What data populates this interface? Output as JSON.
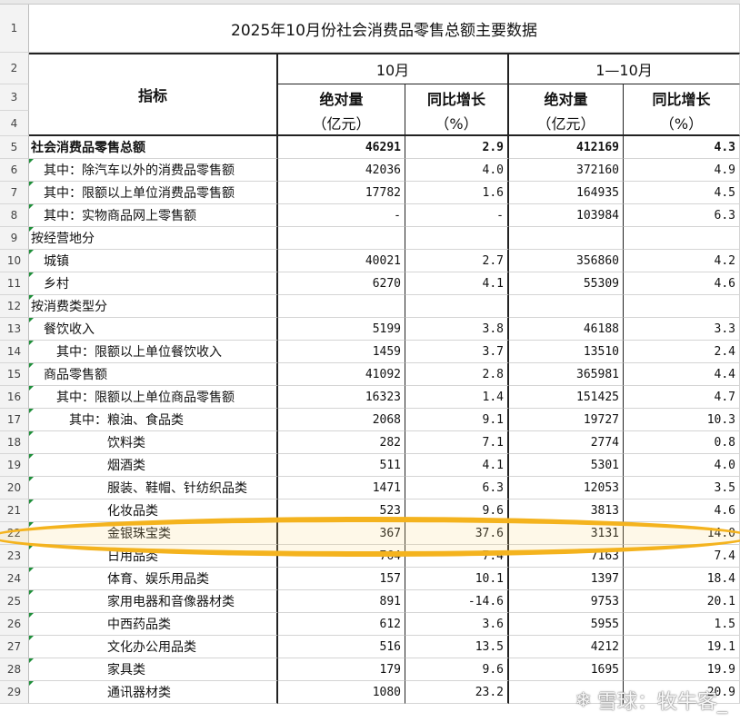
{
  "title": "2025年10月份社会消费品零售总额主要数据",
  "header": {
    "indicator": "指标",
    "period1": "10月",
    "period2": "1—10月",
    "abs_value": "绝对量",
    "yoy_growth": "同比增长",
    "unit_abs": "（亿元）",
    "unit_pct": "（%）"
  },
  "row_numbers": [
    "1",
    "2",
    "3",
    "4",
    "5",
    "6",
    "7",
    "8",
    "9",
    "10",
    "11",
    "12",
    "13",
    "14",
    "15",
    "16",
    "17",
    "18",
    "19",
    "20",
    "21",
    "22",
    "23",
    "24",
    "25",
    "26",
    "27",
    "28",
    "29"
  ],
  "rows": [
    {
      "label": "社会消费品零售总额",
      "indent": 0,
      "bold": true,
      "m_abs": "46291",
      "m_yoy": "2.9",
      "c_abs": "412169",
      "c_yoy": "4.3"
    },
    {
      "label": "其中：除汽车以外的消费品零售额",
      "indent": 1,
      "m_abs": "42036",
      "m_yoy": "4.0",
      "c_abs": "372160",
      "c_yoy": "4.9"
    },
    {
      "label": "其中：限额以上单位消费品零售额",
      "indent": 1,
      "m_abs": "17782",
      "m_yoy": "1.6",
      "c_abs": "164935",
      "c_yoy": "4.5"
    },
    {
      "label": "其中：实物商品网上零售额",
      "indent": 1,
      "m_abs": "-",
      "m_yoy": "-",
      "c_abs": "103984",
      "c_yoy": "6.3"
    },
    {
      "label": "按经营地分",
      "indent": 0,
      "m_abs": "",
      "m_yoy": "",
      "c_abs": "",
      "c_yoy": ""
    },
    {
      "label": "城镇",
      "indent": 1,
      "m_abs": "40021",
      "m_yoy": "2.7",
      "c_abs": "356860",
      "c_yoy": "4.2"
    },
    {
      "label": "乡村",
      "indent": 1,
      "m_abs": "6270",
      "m_yoy": "4.1",
      "c_abs": "55309",
      "c_yoy": "4.6"
    },
    {
      "label": "按消费类型分",
      "indent": 0,
      "m_abs": "",
      "m_yoy": "",
      "c_abs": "",
      "c_yoy": ""
    },
    {
      "label": "餐饮收入",
      "indent": 1,
      "m_abs": "5199",
      "m_yoy": "3.8",
      "c_abs": "46188",
      "c_yoy": "3.3"
    },
    {
      "label": "其中：限额以上单位餐饮收入",
      "indent": 2,
      "m_abs": "1459",
      "m_yoy": "3.7",
      "c_abs": "13510",
      "c_yoy": "2.4"
    },
    {
      "label": "商品零售额",
      "indent": 1,
      "m_abs": "41092",
      "m_yoy": "2.8",
      "c_abs": "365981",
      "c_yoy": "4.4"
    },
    {
      "label": "其中：限额以上单位商品零售额",
      "indent": 2,
      "m_abs": "16323",
      "m_yoy": "1.4",
      "c_abs": "151425",
      "c_yoy": "4.7"
    },
    {
      "label": "其中：粮油、食品类",
      "indent": 3,
      "m_abs": "2068",
      "m_yoy": "9.1",
      "c_abs": "19727",
      "c_yoy": "10.3"
    },
    {
      "label": "饮料类",
      "indent": 4,
      "m_abs": "282",
      "m_yoy": "7.1",
      "c_abs": "2774",
      "c_yoy": "0.8"
    },
    {
      "label": "烟酒类",
      "indent": 4,
      "m_abs": "511",
      "m_yoy": "4.1",
      "c_abs": "5301",
      "c_yoy": "4.0"
    },
    {
      "label": "服装、鞋帽、针纺织品类",
      "indent": 4,
      "m_abs": "1471",
      "m_yoy": "6.3",
      "c_abs": "12053",
      "c_yoy": "3.5"
    },
    {
      "label": "化妆品类",
      "indent": 4,
      "m_abs": "523",
      "m_yoy": "9.6",
      "c_abs": "3813",
      "c_yoy": "4.6"
    },
    {
      "label": "金银珠宝类",
      "indent": 4,
      "m_abs": "367",
      "m_yoy": "37.6",
      "c_abs": "3131",
      "c_yoy": "14.0"
    },
    {
      "label": "日用品类",
      "indent": 4,
      "m_abs": "764",
      "m_yoy": "7.4",
      "c_abs": "7163",
      "c_yoy": "7.4"
    },
    {
      "label": "体育、娱乐用品类",
      "indent": 4,
      "m_abs": "157",
      "m_yoy": "10.1",
      "c_abs": "1397",
      "c_yoy": "18.4"
    },
    {
      "label": "家用电器和音像器材类",
      "indent": 4,
      "m_abs": "891",
      "m_yoy": "-14.6",
      "c_abs": "9753",
      "c_yoy": "20.1"
    },
    {
      "label": "中西药品类",
      "indent": 4,
      "m_abs": "612",
      "m_yoy": "3.6",
      "c_abs": "5955",
      "c_yoy": "1.5"
    },
    {
      "label": "文化办公用品类",
      "indent": 4,
      "m_abs": "516",
      "m_yoy": "13.5",
      "c_abs": "4212",
      "c_yoy": "19.1"
    },
    {
      "label": "家具类",
      "indent": 4,
      "m_abs": "179",
      "m_yoy": "9.6",
      "c_abs": "1695",
      "c_yoy": "19.9"
    },
    {
      "label": "通讯器材类",
      "indent": 4,
      "m_abs": "1080",
      "m_yoy": "23.2",
      "c_abs": "",
      "c_yoy": "20.9"
    }
  ],
  "highlight_row": 17,
  "watermark": {
    "icon": "snowball-icon",
    "text": "雪球：牧牛客_"
  },
  "colors": {
    "highlight": "#f4b31e",
    "error_marker": "#1f8f3a"
  }
}
